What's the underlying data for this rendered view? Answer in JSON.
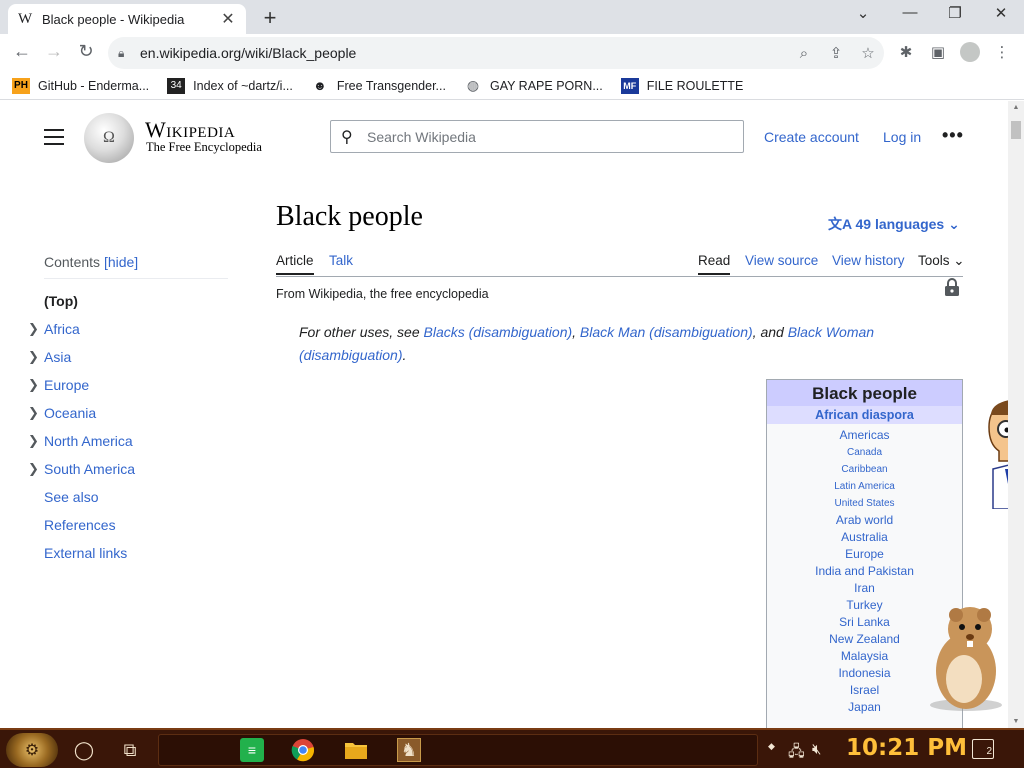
{
  "browser": {
    "tab_title": "Black people - Wikipedia",
    "tab_favicon": "W",
    "url": "en.wikipedia.org/wiki/Black_people",
    "bookmarks": [
      {
        "icon": "PH",
        "label": "GitHub - Enderma..."
      },
      {
        "icon": "34",
        "label": "Index of ~dartz/i..."
      },
      {
        "icon": "mask",
        "label": "Free Transgender..."
      },
      {
        "icon": "globe",
        "label": "GAY RAPE PORN..."
      },
      {
        "icon": "MF",
        "label": "FILE ROULETTE"
      }
    ]
  },
  "wiki_header": {
    "wordmark": "Wikipedia",
    "tagline": "The Free Encyclopedia",
    "search_placeholder": "Search Wikipedia",
    "create_account": "Create account",
    "login": "Log in"
  },
  "toc": {
    "heading": "Contents",
    "hide": "[hide]",
    "items": [
      {
        "label": "(Top)",
        "expandable": false
      },
      {
        "label": "Africa",
        "expandable": true
      },
      {
        "label": "Asia",
        "expandable": true
      },
      {
        "label": "Europe",
        "expandable": true
      },
      {
        "label": "Oceania",
        "expandable": true
      },
      {
        "label": "North America",
        "expandable": true
      },
      {
        "label": "South America",
        "expandable": true
      },
      {
        "label": "See also",
        "expandable": false
      },
      {
        "label": "References",
        "expandable": false
      },
      {
        "label": "External links",
        "expandable": false
      }
    ]
  },
  "article": {
    "title": "Black people",
    "languages": "49 languages",
    "tabs_left": [
      "Article",
      "Talk"
    ],
    "tabs_right": [
      "Read",
      "View source",
      "View history",
      "Tools"
    ],
    "from": "From Wikipedia, the free encyclopedia",
    "hatnote": {
      "prefix": "For other uses, see ",
      "link1": "Blacks (disambiguation)",
      "sep1": ", ",
      "link2": "Black Man (disambiguation)",
      "sep2": ", and ",
      "link3": "Black Woman (disambiguation)",
      "end": "."
    }
  },
  "infobox": {
    "title": "Black people",
    "subtitle": "African diaspora",
    "items": [
      {
        "label": "Americas",
        "small": false
      },
      {
        "label": "Canada",
        "small": true
      },
      {
        "label": "Caribbean",
        "small": true
      },
      {
        "label": "Latin America",
        "small": true
      },
      {
        "label": "United States",
        "small": true
      },
      {
        "label": "Arab world",
        "small": false
      },
      {
        "label": "Australia",
        "small": false
      },
      {
        "label": "Europe",
        "small": false
      },
      {
        "label": "India and Pakistan",
        "small": false
      },
      {
        "label": "Iran",
        "small": false
      },
      {
        "label": "Turkey",
        "small": false
      },
      {
        "label": "Sri Lanka",
        "small": false
      },
      {
        "label": "New Zealand",
        "small": false
      },
      {
        "label": "Malaysia",
        "small": false
      },
      {
        "label": "Indonesia",
        "small": false
      },
      {
        "label": "Israel",
        "small": false
      },
      {
        "label": "Japan",
        "small": false
      }
    ]
  },
  "taskbar": {
    "clock": "10:21 PM",
    "notifications": "2"
  }
}
